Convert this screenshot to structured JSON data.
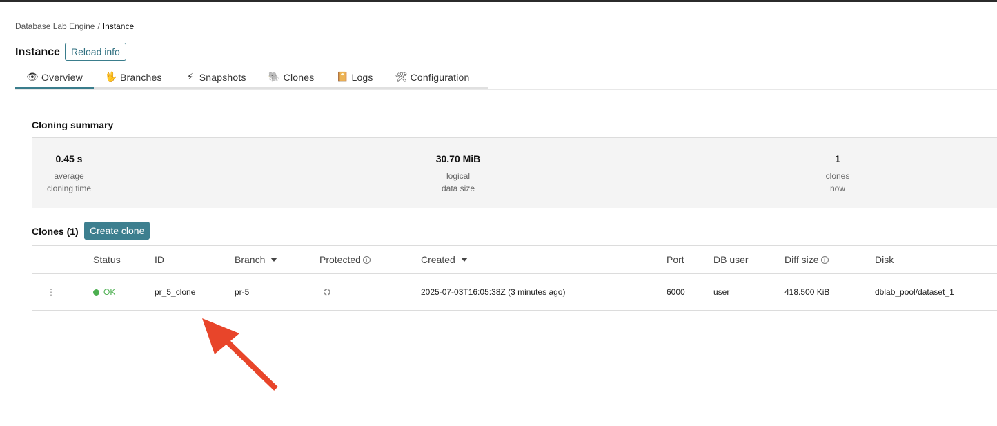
{
  "breadcrumb": {
    "root": "Database Lab Engine",
    "separator": "/",
    "current": "Instance"
  },
  "header": {
    "title": "Instance",
    "reload_label": "Reload info"
  },
  "tabs": [
    {
      "label": "Overview",
      "icon": "eye-icon",
      "glyph": "👁",
      "active": true
    },
    {
      "label": "Branches",
      "icon": "hand-icon",
      "glyph": "🖖",
      "active": false
    },
    {
      "label": "Snapshots",
      "icon": "lightning-icon",
      "glyph": "⚡",
      "active": false
    },
    {
      "label": "Clones",
      "icon": "elephant-icon",
      "glyph": "🐘",
      "active": false
    },
    {
      "label": "Logs",
      "icon": "notebook-icon",
      "glyph": "📔",
      "active": false
    },
    {
      "label": "Configuration",
      "icon": "tools-icon",
      "glyph": "🛠",
      "active": false
    }
  ],
  "summary": {
    "title": "Cloning summary",
    "stats": [
      {
        "value": "0.45 s",
        "label1": "average",
        "label2": "cloning time"
      },
      {
        "value": "30.70 MiB",
        "label1": "logical",
        "label2": "data size"
      },
      {
        "value": "1",
        "label1": "clones",
        "label2": "now"
      }
    ]
  },
  "clones": {
    "title": "Clones (1)",
    "create_label": "Create clone",
    "columns": {
      "status": "Status",
      "id": "ID",
      "branch": "Branch",
      "protected": "Protected",
      "created": "Created",
      "port": "Port",
      "db_user": "DB user",
      "diff_size": "Diff size",
      "disk": "Disk"
    },
    "rows": [
      {
        "menu": "⋮",
        "status": "OK",
        "status_color": "#4caf50",
        "id": "pr_5_clone",
        "branch": "pr-5",
        "protected_icon": "spinner-icon",
        "created": "2025-07-03T16:05:38Z (3 minutes ago)",
        "port": "6000",
        "db_user": "user",
        "diff_size": "418.500 KiB",
        "disk": "dblab_pool/dataset_1"
      }
    ]
  },
  "colors": {
    "accent": "#3a7d8c",
    "arrow": "#e8452a"
  }
}
